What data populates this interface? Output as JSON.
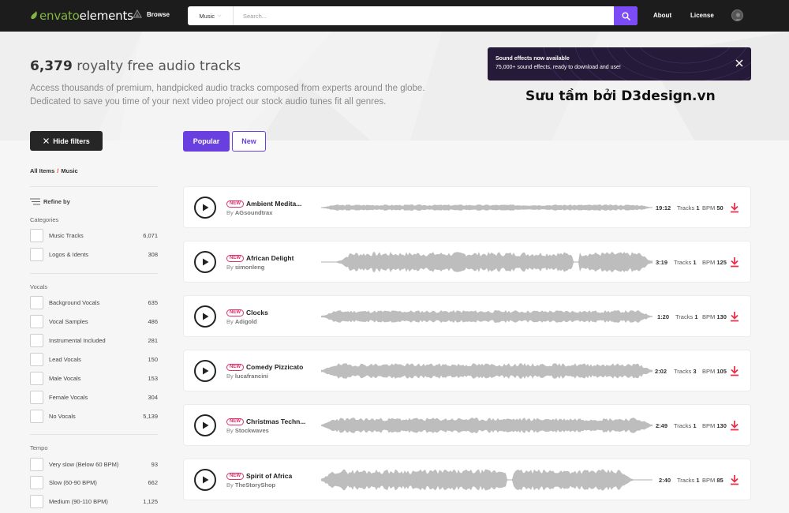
{
  "header": {
    "logo_brand": "envato",
    "logo_product": "elements",
    "browse_label": "Browse",
    "search_category": "Music",
    "search_placeholder": "Search...",
    "nav_about": "About",
    "nav_license": "License"
  },
  "hero": {
    "count": "6,379",
    "title_rest": "royalty free audio tracks",
    "description_line1": "Access thousands of premium, handpicked audio tracks composed from experts around the globe.",
    "description_line2": "Dedicated to save you time of your next video project our stock audio tunes fit all genres.",
    "promo_title": "Sound effects now available",
    "promo_subtitle": "75,000+ sound effects, ready to download and use!",
    "credit": "Sưu tầm bởi D3design.vn"
  },
  "sidebar": {
    "hide_filters_label": "Hide filters",
    "breadcrumb_root": "All Items",
    "breadcrumb_separator": "/",
    "breadcrumb_current": "Music",
    "refine_label": "Refine by",
    "groups": [
      {
        "title": "Categories",
        "items": [
          {
            "label": "Music Tracks",
            "count": "6,071"
          },
          {
            "label": "Logos & Idents",
            "count": "308"
          }
        ]
      },
      {
        "title": "Vocals",
        "items": [
          {
            "label": "Background Vocals",
            "count": "635"
          },
          {
            "label": "Vocal Samples",
            "count": "486"
          },
          {
            "label": "Instrumental Included",
            "count": "281"
          },
          {
            "label": "Lead Vocals",
            "count": "150"
          },
          {
            "label": "Male Vocals",
            "count": "153"
          },
          {
            "label": "Female Vocals",
            "count": "304"
          },
          {
            "label": "No Vocals",
            "count": "5,139"
          }
        ]
      },
      {
        "title": "Tempo",
        "items": [
          {
            "label": "Very slow (Below 60 BPM)",
            "count": "93"
          },
          {
            "label": "Slow (60-90 BPM)",
            "count": "662"
          },
          {
            "label": "Medium (90-110 BPM)",
            "count": "1,125"
          }
        ]
      }
    ]
  },
  "tabs": {
    "popular": "Popular",
    "new": "New"
  },
  "tracks": [
    {
      "badge": "NEW",
      "title": "Ambient Medita...",
      "by": "By",
      "author": "AGsoundtrax",
      "duration": "19:12",
      "tracks_label": "Tracks",
      "tracks": "1",
      "bpm_label": "BPM",
      "bpm": "50",
      "wave_color": "#bdbdbd"
    },
    {
      "badge": "NEW",
      "title": "African Delight",
      "by": "By",
      "author": "simonleng",
      "duration": "3:19",
      "tracks_label": "Tracks",
      "tracks": "1",
      "bpm_label": "BPM",
      "bpm": "125",
      "wave_color": "#bdbdbd"
    },
    {
      "badge": "NEW",
      "title": "Clocks",
      "by": "By",
      "author": "Adigold",
      "duration": "1:20",
      "tracks_label": "Tracks",
      "tracks": "1",
      "bpm_label": "BPM",
      "bpm": "130",
      "wave_color": "#bdbdbd"
    },
    {
      "badge": "NEW",
      "title": "Comedy Pizzicato",
      "by": "By",
      "author": "lucafrancini",
      "duration": "2:02",
      "tracks_label": "Tracks",
      "tracks": "3",
      "bpm_label": "BPM",
      "bpm": "105",
      "wave_color": "#bdbdbd"
    },
    {
      "badge": "NEW",
      "title": "Christmas Techn...",
      "by": "By",
      "author": "Stockwaves",
      "duration": "2:49",
      "tracks_label": "Tracks",
      "tracks": "1",
      "bpm_label": "BPM",
      "bpm": "130",
      "wave_color": "#bdbdbd"
    },
    {
      "badge": "NEW",
      "title": "Spirit of Africa",
      "by": "By",
      "author": "TheStoryShop",
      "duration": "2:40",
      "tracks_label": "Tracks",
      "tracks": "1",
      "bpm_label": "BPM",
      "bpm": "85",
      "wave_color": "#bdbdbd"
    }
  ],
  "icons": {
    "search": "search-icon",
    "play": "play-icon",
    "download": "download-icon",
    "close": "close-icon",
    "user": "user-icon"
  },
  "colors": {
    "accent": "#7b4cf5",
    "brand_green": "#82b541",
    "new_badge": "#e0306a",
    "download": "#e8334a"
  }
}
